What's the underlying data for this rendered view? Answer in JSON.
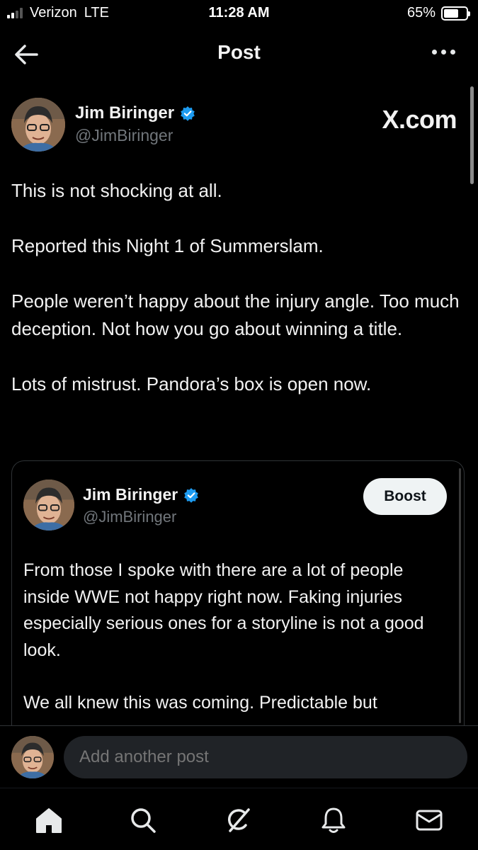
{
  "status_bar": {
    "carrier": "Verizon",
    "network": "LTE",
    "time": "11:28 AM",
    "battery": "65%",
    "battery_level": 0.65
  },
  "nav": {
    "title": "Post",
    "back_icon": "arrow-left-icon",
    "more_icon": "more-horizontal-icon"
  },
  "post": {
    "author_name": "Jim Biringer",
    "author_handle": "@JimBiringer",
    "verified": true,
    "watermark": "X.com",
    "paragraphs": [
      "This is not shocking at all.",
      "Reported this Night 1 of Summerslam.",
      "People weren’t happy about the injury angle. Too much deception. Not how you go about winning a title.",
      "Lots of mistrust. Pandora’s box is open now."
    ]
  },
  "quoted_post": {
    "author_name": "Jim Biringer",
    "author_handle": "@JimBiringer",
    "verified": true,
    "boost_label": "Boost",
    "paragraphs": [
      "From those I spoke with there are a lot of people inside WWE not happy right now. Faking injuries especially serious ones for a storyline is not a good look.",
      "We all knew this was coming. Predictable but"
    ]
  },
  "reply": {
    "placeholder": "Add another post"
  },
  "tabs": [
    {
      "name": "home",
      "icon": "home-icon"
    },
    {
      "name": "search",
      "icon": "search-icon"
    },
    {
      "name": "grok",
      "icon": "grok-icon"
    },
    {
      "name": "notifications",
      "icon": "bell-icon"
    },
    {
      "name": "messages",
      "icon": "mail-icon"
    }
  ],
  "colors": {
    "background": "#000000",
    "text": "#f2f2f2",
    "secondary_text": "#71767b",
    "verified_blue": "#1d9bf0",
    "input_bg": "#202327",
    "border": "#2f3336"
  }
}
